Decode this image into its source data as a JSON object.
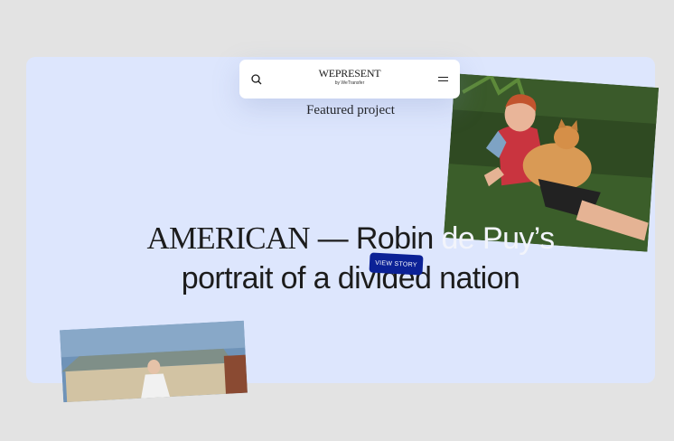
{
  "nav": {
    "logo_main": "WEPRESENT",
    "logo_sub": "by WeTransfer",
    "search_icon": "search-icon",
    "menu_icon": "menu-icon"
  },
  "featured": {
    "label": "Featured project"
  },
  "headline": {
    "part1": "AMERICAN",
    "part2": " — Robin ",
    "part3": "de Puy’s",
    "line2a": "portrait of a divi",
    "line2b": "ded nation"
  },
  "cta": {
    "label": "VIEW STORY"
  },
  "colors": {
    "page_bg": "#e3e3e3",
    "hero_bg": "#dde6fd",
    "cta_bg": "#0b2196"
  }
}
